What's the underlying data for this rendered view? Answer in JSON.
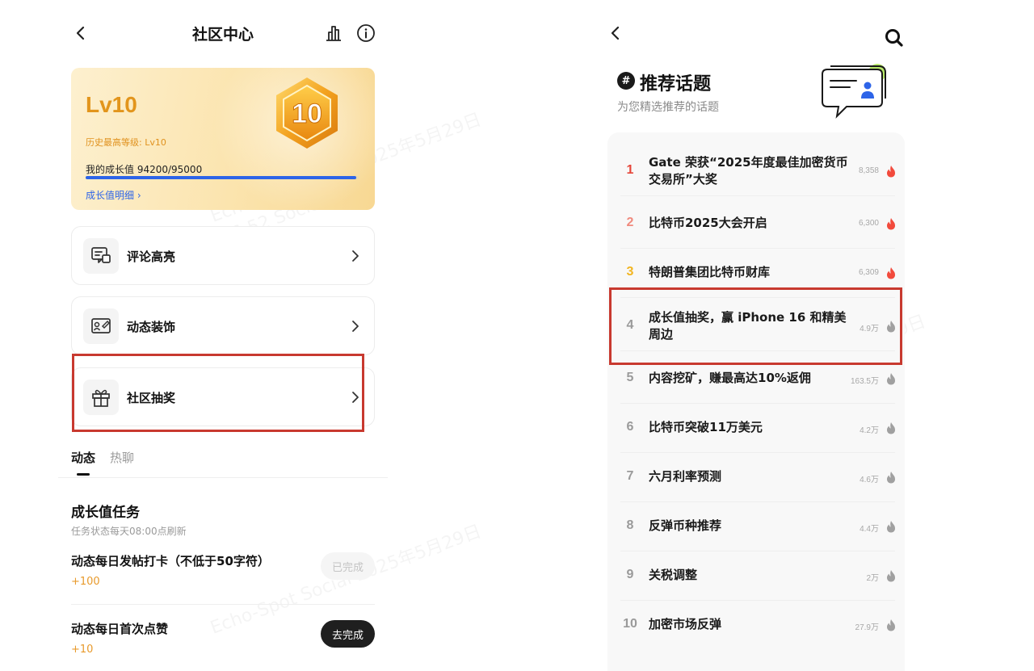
{
  "left": {
    "header": {
      "title": "社区中心"
    },
    "level_card": {
      "level": "Lv10",
      "badge_number": "10",
      "history_max": "历史最高等级: Lv10",
      "growth_value": "我的成长值 94200/95000",
      "growth_progress": 0.9916,
      "growth_detail_link": "成长值明细"
    },
    "menu": [
      {
        "label": "评论高亮"
      },
      {
        "label": "动态装饰"
      },
      {
        "label": "社区抽奖"
      }
    ],
    "tabs": [
      {
        "label": "动态"
      },
      {
        "label": "热聊"
      }
    ],
    "tasks_section": {
      "title": "成长值任务",
      "subtitle": "任务状态每天08:00点刷新",
      "items": [
        {
          "name": "动态每日发帖打卡（不低于50字符）",
          "points": "+100",
          "button": "已完成"
        },
        {
          "name": "动态每日首次点赞",
          "points": "+10",
          "button": "去完成"
        }
      ]
    }
  },
  "right": {
    "header": {
      "title": "推荐话题",
      "hash_symbol": "#",
      "subtitle": "为您精选推荐的话题"
    },
    "topics": [
      {
        "rank": "1",
        "text": "Gate 荣获“2025年度最佳加密货币交易所”大奖",
        "heat": "8,358"
      },
      {
        "rank": "2",
        "text": "比特币2025大会开启",
        "heat": "6,300"
      },
      {
        "rank": "3",
        "text": "特朗普集团比特币财库",
        "heat": "6,309"
      },
      {
        "rank": "4",
        "text": "成长值抽奖，赢 iPhone 16 和精美周边",
        "heat": "4.9万"
      },
      {
        "rank": "5",
        "text": "内容挖矿，赚最高达10%返佣",
        "heat": "163.5万"
      },
      {
        "rank": "6",
        "text": "比特币突破11万美元",
        "heat": "4.2万"
      },
      {
        "rank": "7",
        "text": "六月利率预测",
        "heat": "4.6万"
      },
      {
        "rank": "8",
        "text": "反弹币种推荐",
        "heat": "4.4万"
      },
      {
        "rank": "9",
        "text": "关税调整",
        "heat": "2万"
      },
      {
        "rank": "10",
        "text": "加密市场反弹",
        "heat": "27.9万"
      }
    ],
    "colors": {
      "rank_1": "#e5463a",
      "rank_2": "#f08a7e",
      "rank_3": "#f2b520",
      "rank_other": "#9a9a9a",
      "flame_hot": "#f24a3c",
      "flame_cold": "#a0a0a0"
    }
  },
  "watermark": {
    "date_text": "Echo-Spot Social 2025年5月29日",
    "time_text": "16:52 Social"
  }
}
